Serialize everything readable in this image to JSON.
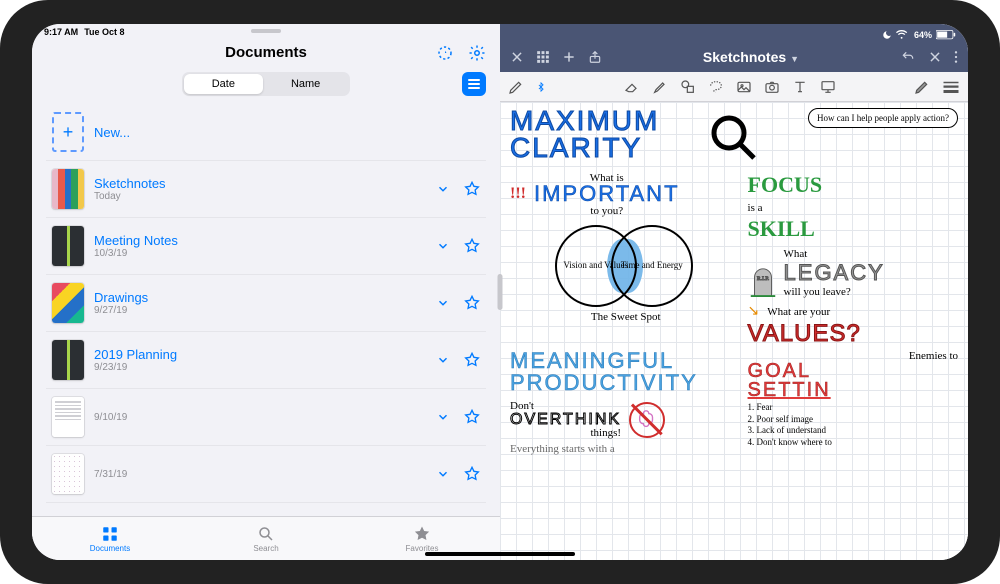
{
  "status": {
    "time": "9:17 AM",
    "date": "Tue Oct 8",
    "battery": "64%"
  },
  "left": {
    "title": "Documents",
    "segmented": {
      "date": "Date",
      "name": "Name"
    },
    "new_label": "New...",
    "tabs": {
      "documents": "Documents",
      "search": "Search",
      "favorites": "Favorites"
    },
    "items": [
      {
        "title": "Sketchnotes",
        "subtitle": "Today",
        "thumb": "stripes"
      },
      {
        "title": "Meeting Notes",
        "subtitle": "10/3/19",
        "thumb": "book"
      },
      {
        "title": "Drawings",
        "subtitle": "9/27/19",
        "thumb": "wave"
      },
      {
        "title": "2019 Planning",
        "subtitle": "9/23/19",
        "thumb": "book"
      },
      {
        "title": "",
        "subtitle": "9/10/19",
        "thumb": "doc"
      },
      {
        "title": "",
        "subtitle": "7/31/19",
        "thumb": "grid"
      }
    ]
  },
  "right": {
    "title": "Sketchnotes"
  },
  "note": {
    "maximum_clarity_l1": "MAXIMUM",
    "maximum_clarity_l2": "CLARITY",
    "speech": "How can I help people apply action?",
    "what_is": "What is",
    "important": "IMPORTANT",
    "to_you": "to you?",
    "exclaim": "!!!",
    "focus_l1": "FOCUS",
    "focus_l2": "is a",
    "focus_l3": "SKILL",
    "venn_left": "Vision and Values",
    "venn_right": "Time and Energy",
    "sweet_spot": "The Sweet Spot",
    "rip": "R.I.P.",
    "legacy_q": "What",
    "legacy": "LEGACY",
    "legacy_sub": "will you leave?",
    "values_q": "What are your",
    "values": "VALUES",
    "values_mark": "?",
    "mp_l1": "MEANINGFUL",
    "mp_l2": "PRODUCTIVITY",
    "enemies": "Enemies to",
    "goal_l1": "GOAL",
    "goal_l2": "SETTIN",
    "overthink_pre": "Don't",
    "overthink": "OVERTHINK",
    "overthink_sub": "things!",
    "list_1": "1. Fear",
    "list_2": "2. Poor self image",
    "list_3": "3. Lack of understand",
    "list_4": "4. Don't know where to",
    "footer": "Everything starts with a"
  }
}
